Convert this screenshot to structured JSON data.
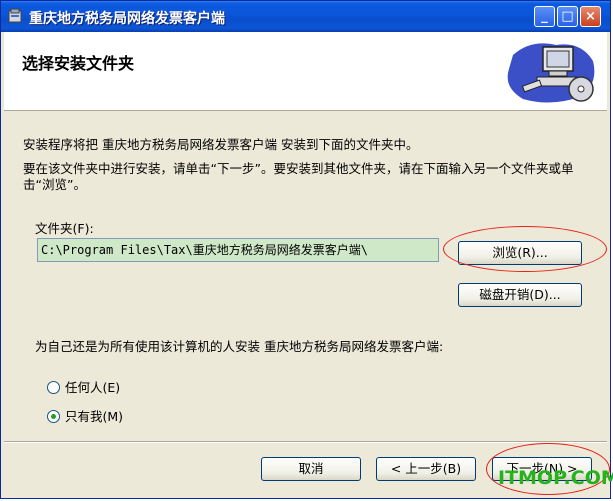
{
  "window": {
    "title": "重庆地方税务局网络发票客户端",
    "controls": {
      "minimize": "_",
      "maximize": "□",
      "close": "×"
    }
  },
  "header": {
    "title": "选择安装文件夹",
    "art_icon": "computer-install-icon"
  },
  "body": {
    "intro": "安装程序将把 重庆地方税务局网络发票客户端 安装到下面的文件夹中。",
    "instruction": "要在该文件夹中进行安装，请单击“下一步”。要安装到其他文件夹，请在下面输入另一个文件夹或单击“浏览”。",
    "folder_label": "文件夹(F):",
    "folder_path": "C:\\Program Files\\Tax\\重庆地方税务局网络发票客户端\\",
    "browse_label": "浏览(R)...",
    "disk_cost_label": "磁盘开销(D)...",
    "install_for_label": "为自己还是为所有使用该计算机的人安装 重庆地方税务局网络发票客户端:",
    "options": [
      {
        "label": "任何人(E)",
        "selected": false
      },
      {
        "label": "只有我(M)",
        "selected": true
      }
    ]
  },
  "footer": {
    "cancel_label": "取消",
    "back_label": "< 上一步(B)",
    "next_label": "下一步(N) >"
  },
  "watermark": "ITMOP.COM",
  "colors": {
    "titlebar": "#0a4ecb",
    "annotation": "#e8201a",
    "path_bg": "#cfe8c7",
    "watermark": "#25b31c"
  }
}
